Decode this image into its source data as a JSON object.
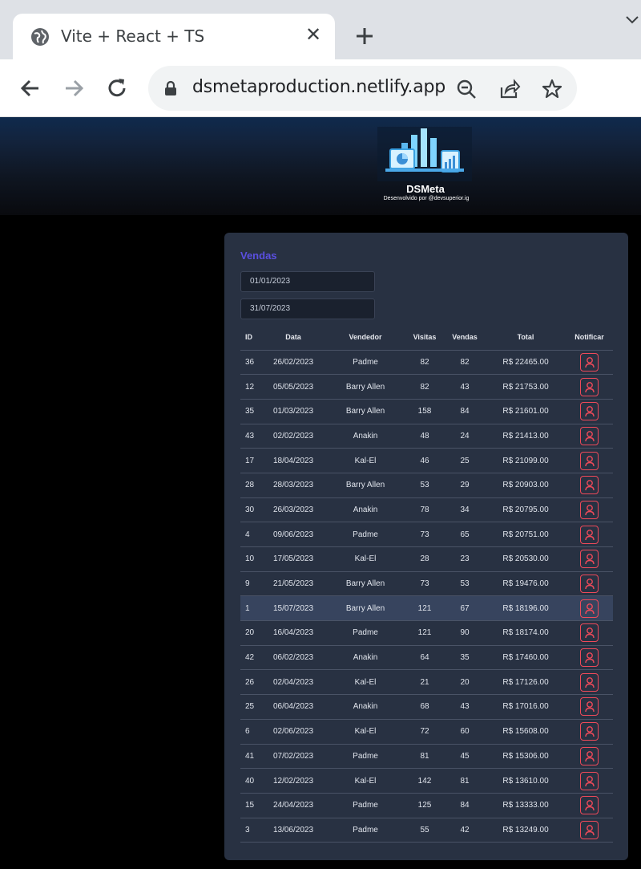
{
  "browser": {
    "tab_title": "Vite + React + TS",
    "url": "dsmetaproduction.netlify.app"
  },
  "header": {
    "brand": "DSMeta",
    "subtitle": "Desenvolvido por @devsuperior.ig"
  },
  "card": {
    "title": "Vendas",
    "date_min": "01/01/2023",
    "date_max": "31/07/2023"
  },
  "table": {
    "columns": [
      "ID",
      "Data",
      "Vendedor",
      "Visitas",
      "Vendas",
      "Total",
      "Notificar"
    ],
    "rows": [
      [
        "36",
        "26/02/2023",
        "Padme",
        "82",
        "82",
        "R$ 22465.00"
      ],
      [
        "12",
        "05/05/2023",
        "Barry Allen",
        "82",
        "43",
        "R$ 21753.00"
      ],
      [
        "35",
        "01/03/2023",
        "Barry Allen",
        "158",
        "84",
        "R$ 21601.00"
      ],
      [
        "43",
        "02/02/2023",
        "Anakin",
        "48",
        "24",
        "R$ 21413.00"
      ],
      [
        "17",
        "18/04/2023",
        "Kal-El",
        "46",
        "25",
        "R$ 21099.00"
      ],
      [
        "28",
        "28/03/2023",
        "Barry Allen",
        "53",
        "29",
        "R$ 20903.00"
      ],
      [
        "30",
        "26/03/2023",
        "Anakin",
        "78",
        "34",
        "R$ 20795.00"
      ],
      [
        "4",
        "09/06/2023",
        "Padme",
        "73",
        "65",
        "R$ 20751.00"
      ],
      [
        "10",
        "17/05/2023",
        "Kal-El",
        "28",
        "23",
        "R$ 20530.00"
      ],
      [
        "9",
        "21/05/2023",
        "Barry Allen",
        "73",
        "53",
        "R$ 19476.00"
      ],
      [
        "1",
        "15/07/2023",
        "Barry Allen",
        "121",
        "67",
        "R$ 18196.00"
      ],
      [
        "20",
        "16/04/2023",
        "Padme",
        "121",
        "90",
        "R$ 18174.00"
      ],
      [
        "42",
        "06/02/2023",
        "Anakin",
        "64",
        "35",
        "R$ 17460.00"
      ],
      [
        "26",
        "02/04/2023",
        "Kal-El",
        "21",
        "20",
        "R$ 17126.00"
      ],
      [
        "25",
        "06/04/2023",
        "Anakin",
        "68",
        "43",
        "R$ 17016.00"
      ],
      [
        "6",
        "02/06/2023",
        "Kal-El",
        "72",
        "60",
        "R$ 15608.00"
      ],
      [
        "41",
        "07/02/2023",
        "Padme",
        "81",
        "45",
        "R$ 15306.00"
      ],
      [
        "40",
        "12/02/2023",
        "Kal-El",
        "142",
        "81",
        "R$ 13610.00"
      ],
      [
        "15",
        "24/04/2023",
        "Padme",
        "125",
        "84",
        "R$ 13333.00"
      ],
      [
        "3",
        "13/06/2023",
        "Padme",
        "55",
        "42",
        "R$ 13249.00"
      ]
    ],
    "highlighted_row": 10
  },
  "colors": {
    "accent": "#5a4fe0",
    "notify": "#ef4a5a",
    "card_bg": "#283142"
  }
}
